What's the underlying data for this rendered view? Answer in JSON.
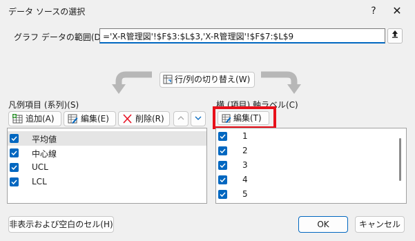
{
  "window": {
    "title": "データ ソースの選択",
    "help_icon": "?",
    "close_icon": "✕"
  },
  "range": {
    "label": "グラフ データの範囲(D):",
    "value": "='X-R管理図'!$F$3:$L$3,'X-R管理図'!$F$7:$L$9",
    "collapse_icon": "up-arrow-icon"
  },
  "switch": {
    "label": "行/列の切り替え(W)"
  },
  "series": {
    "label": "凡例項目 (系列)(S)",
    "add_label": "追加(A)",
    "edit_label": "編集(E)",
    "delete_label": "削除(R)",
    "items": [
      {
        "name": "平均値",
        "checked": true,
        "selected": true
      },
      {
        "name": "中心線",
        "checked": true,
        "selected": false
      },
      {
        "name": "UCL",
        "checked": true,
        "selected": false
      },
      {
        "name": "LCL",
        "checked": true,
        "selected": false
      }
    ]
  },
  "axis": {
    "label": "横 (項目) 軸ラベル(C)",
    "edit_label": "編集(T)",
    "items": [
      {
        "name": "1",
        "checked": true
      },
      {
        "name": "2",
        "checked": true
      },
      {
        "name": "3",
        "checked": true
      },
      {
        "name": "4",
        "checked": true
      },
      {
        "name": "5",
        "checked": true
      }
    ]
  },
  "footer": {
    "hidden_cells_label": "非表示および空白のセル(H)",
    "ok_label": "OK",
    "cancel_label": "キャンセル"
  },
  "colors": {
    "accent": "#0067c0",
    "highlight": "#e8101a",
    "delete_red": "#e81123"
  }
}
